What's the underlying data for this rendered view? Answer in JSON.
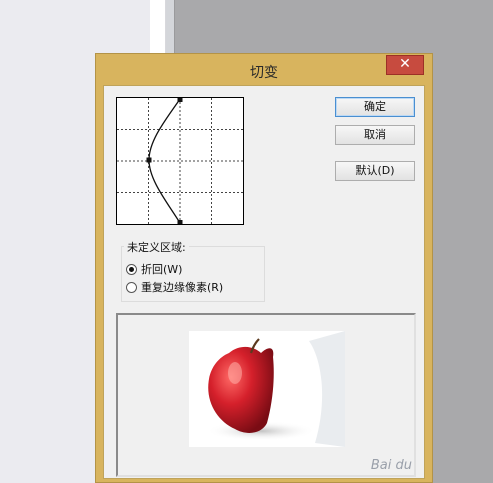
{
  "dialog": {
    "title": "切变",
    "close_label": "✕",
    "buttons": {
      "ok": "确定",
      "cancel": "取消",
      "default": "默认(D)"
    },
    "undefined_area": {
      "label": "未定义区域:",
      "options": [
        {
          "label": "折回(W)",
          "selected": true
        },
        {
          "label": "重复边缘像素(R)",
          "selected": false
        }
      ]
    }
  },
  "colors": {
    "title_bar": "#d8b45e",
    "close_button": "#c74b3f",
    "apple_red": "#d5202b"
  },
  "watermark": "Bai du"
}
